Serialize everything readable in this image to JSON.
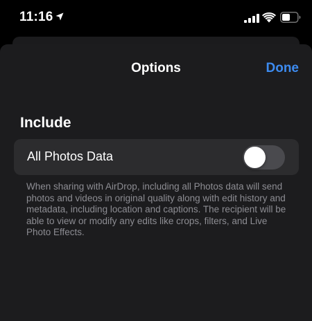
{
  "status_bar": {
    "time": "11:16",
    "icons": [
      "location-arrow-icon",
      "cellular-signal-icon",
      "wifi-icon",
      "battery-icon"
    ]
  },
  "sheet": {
    "title": "Options",
    "done_label": "Done"
  },
  "section": {
    "header": "Include",
    "row_label": "All Photos Data",
    "toggle_on": false,
    "footer": "When sharing with AirDrop, including all Photos data will send photos and videos in original quality along with edit history and metadata, including location and captions. The recipient will be able to view or modify any edits like crops, filters, and Live Photo Effects."
  },
  "colors": {
    "accent": "#3d8bf0",
    "background": "#000000",
    "sheet_background": "#1c1c1e",
    "row_background": "#2c2c2e",
    "toggle_off": "#4a4a4e",
    "secondary_text": "#8d8d93"
  }
}
